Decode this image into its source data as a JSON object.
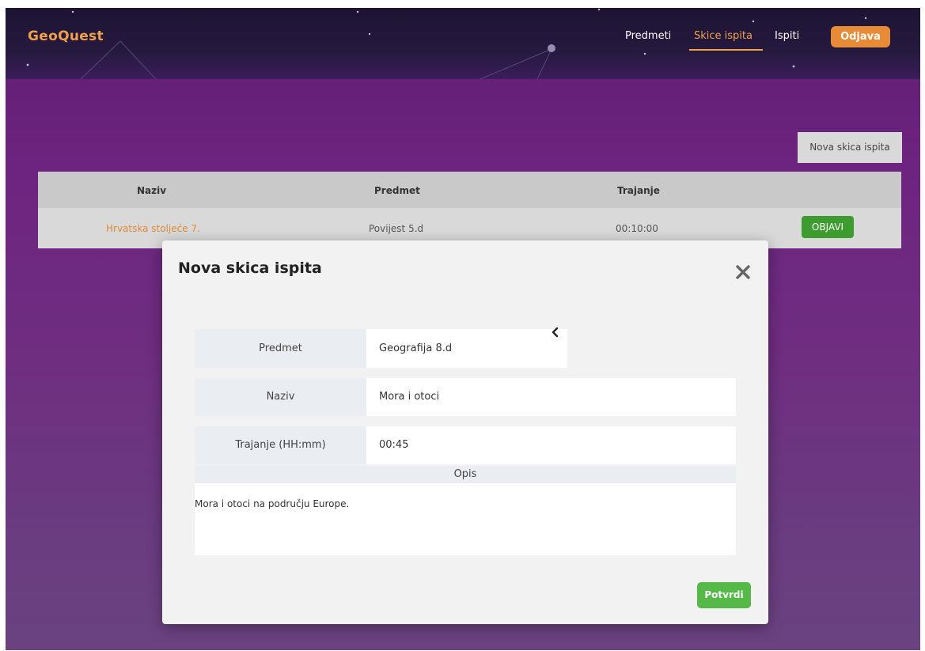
{
  "app": {
    "brand": "GeoQuest"
  },
  "nav": {
    "items": [
      {
        "label": "Predmeti"
      },
      {
        "label": "Skice ispita",
        "active": true
      },
      {
        "label": "Ispiti"
      }
    ],
    "logout_label": "Odjava"
  },
  "toolbar": {
    "new_draft_label": "Nova skica ispita"
  },
  "table": {
    "headers": [
      "Naziv",
      "Predmet",
      "Trajanje"
    ],
    "rows": [
      {
        "name": "Hrvatska stoljeće 7.",
        "subject": "Povijest 5.d",
        "duration": "00:10:00",
        "action": "OBJAVI"
      }
    ]
  },
  "modal": {
    "title": "Nova skica ispita",
    "close_icon": "close-icon",
    "fields": {
      "subject": {
        "label": "Predmet",
        "value": "Geografija 8.d"
      },
      "name": {
        "label": "Naziv",
        "value": "Mora i otoci"
      },
      "duration": {
        "label": "Trajanje (HH:mm)",
        "value": "00:45"
      }
    },
    "description": {
      "label": "Opis",
      "value": "Mora i otoci na području Europe."
    },
    "confirm_label": "Potvrdi"
  },
  "colors": {
    "accent": "#f0a04b",
    "logout_bg": "#e88b36",
    "publish_green": "#3d9b2f",
    "confirm_green": "#55b948",
    "nav_bg": "#1d1433",
    "page_bg": "#6d2480"
  }
}
